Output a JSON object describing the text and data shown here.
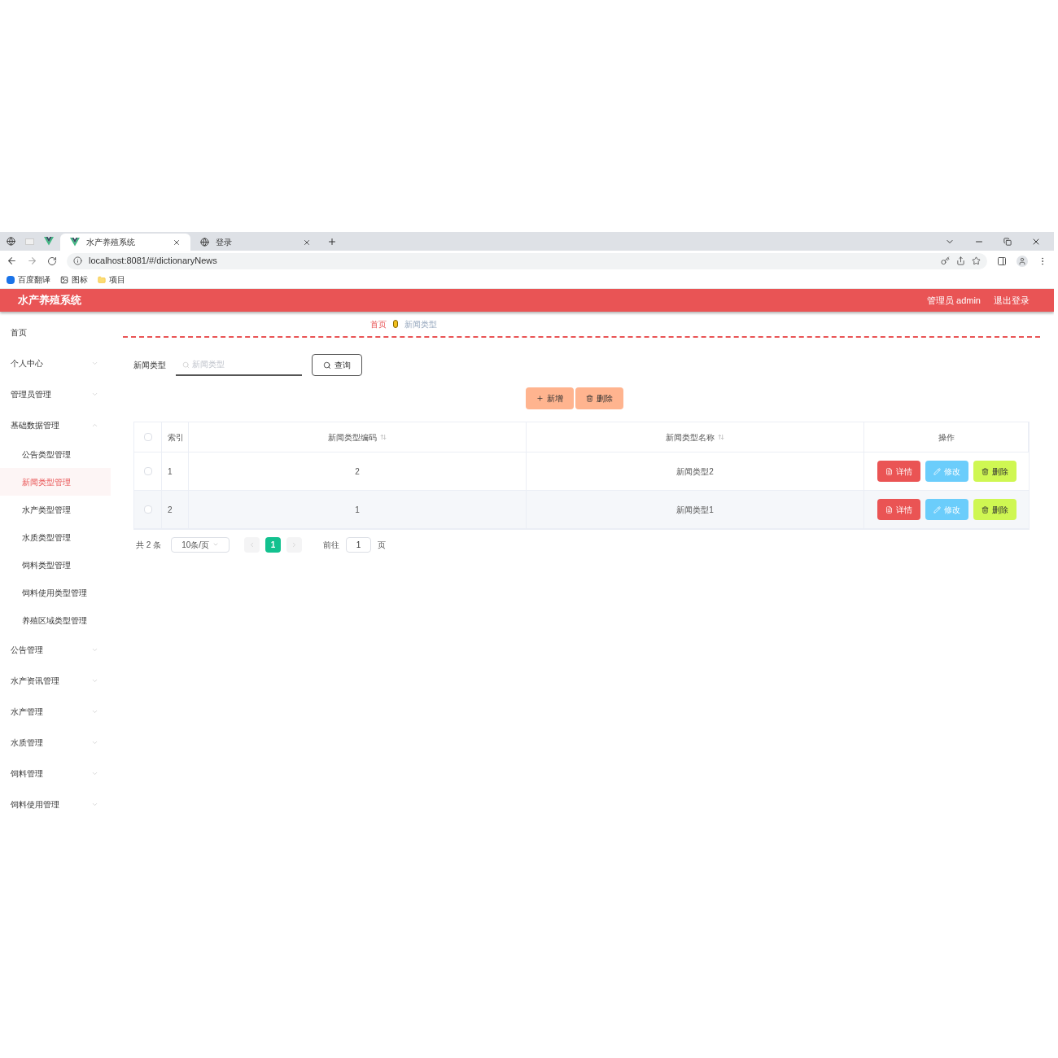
{
  "browser": {
    "tabs": [
      {
        "label": "水产养殖系统",
        "selected": true
      },
      {
        "label": "登录",
        "selected": false
      }
    ],
    "address": "localhost:8081/#/dictionaryNews",
    "bookmarks": [
      "百度翻译",
      "图标",
      "项目"
    ]
  },
  "header": {
    "title": "水产养殖系统",
    "user": "管理员 admin",
    "logout": "退出登录"
  },
  "sidebar": {
    "items": [
      {
        "kind": "link",
        "label": "首页",
        "selected": false
      },
      {
        "kind": "group",
        "label": "个人中心",
        "expanded": false
      },
      {
        "kind": "group",
        "label": "管理员管理",
        "expanded": false
      },
      {
        "kind": "group",
        "label": "基础数据管理",
        "expanded": true,
        "children": [
          {
            "label": "公告类型管理",
            "selected": false
          },
          {
            "label": "新闻类型管理",
            "selected": true
          },
          {
            "label": "水产类型管理",
            "selected": false
          },
          {
            "label": "水质类型管理",
            "selected": false
          },
          {
            "label": "饲料类型管理",
            "selected": false
          },
          {
            "label": "饲料使用类型管理",
            "selected": false
          },
          {
            "label": "养殖区域类型管理",
            "selected": false
          }
        ]
      },
      {
        "kind": "group",
        "label": "公告管理",
        "expanded": false
      },
      {
        "kind": "group",
        "label": "水产资讯管理",
        "expanded": false
      },
      {
        "kind": "group",
        "label": "水产管理",
        "expanded": false
      },
      {
        "kind": "group",
        "label": "水质管理",
        "expanded": false
      },
      {
        "kind": "group",
        "label": "饲料管理",
        "expanded": false
      },
      {
        "kind": "group",
        "label": "饲料使用管理",
        "expanded": false
      }
    ]
  },
  "breadcrumb": [
    "首页",
    "新闻类型"
  ],
  "search": {
    "label": "新闻类型",
    "placeholder": "新闻类型",
    "button": "查询"
  },
  "actions": [
    {
      "kind": "add",
      "label": "新增"
    },
    {
      "kind": "delete",
      "label": "删除"
    }
  ],
  "table": {
    "columns": [
      {
        "label": "索引",
        "sortable": false
      },
      {
        "label": "新闻类型编码",
        "sortable": true
      },
      {
        "label": "新闻类型名称",
        "sortable": true
      },
      {
        "label": "操作",
        "sortable": false
      }
    ],
    "all_checked": false,
    "rows": [
      {
        "checked": false,
        "index": "1",
        "code": "2",
        "name": "新闻类型2",
        "actions": [
          {
            "kind": "detail",
            "label": "详情"
          },
          {
            "kind": "edit",
            "label": "修改"
          },
          {
            "kind": "delete",
            "label": "删除"
          }
        ]
      },
      {
        "checked": false,
        "index": "2",
        "code": "1",
        "name": "新闻类型1",
        "actions": [
          {
            "kind": "detail",
            "label": "详情"
          },
          {
            "kind": "edit",
            "label": "修改"
          },
          {
            "kind": "delete",
            "label": "删除"
          }
        ]
      }
    ]
  },
  "pagination": {
    "total": "共 2 条",
    "page_size": "10条/页",
    "pages": [
      {
        "label": "1",
        "selected": true
      }
    ],
    "goto": "前往",
    "goto_value": "1",
    "unit": "页"
  }
}
